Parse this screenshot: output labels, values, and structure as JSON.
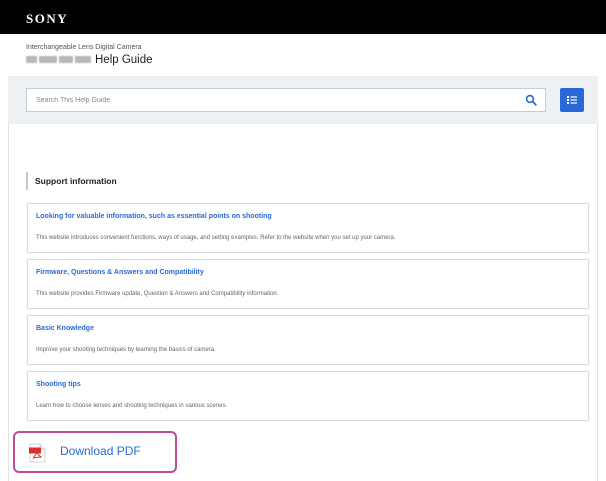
{
  "topbar": {
    "brand": "SONY"
  },
  "header": {
    "subtitle": "Interchangeable Lens Digital Camera",
    "guide_title": "Help Guide"
  },
  "search": {
    "placeholder": "Search This Help Guide",
    "icon": "search-icon"
  },
  "toc_button": {
    "icon": "list-icon"
  },
  "support": {
    "heading": "Support information",
    "items": [
      {
        "title": "Looking for valuable information, such as essential points on shooting",
        "desc": "This website introduces convenient functions, ways of usage, and setting examples. Refer to the website when you set up your camera."
      },
      {
        "title": "Firmware, Questions & Answers and Compatibility",
        "desc": "This website provides Firmware update, Question & Answers and Compatibility information."
      },
      {
        "title": "Basic Knowledge",
        "desc": "Improve your shooting techniques by learning the basics of camera."
      },
      {
        "title": "Shooting tips",
        "desc": "Learn how to choose lenses and shooting techniques in various scenes."
      }
    ]
  },
  "pdf": {
    "label": "Download PDF",
    "icon": "pdf-file-icon"
  },
  "colors": {
    "brand_bar": "#000000",
    "accent": "#2a6ad6",
    "highlight": "#c24a9b",
    "search_band": "#eef1f4"
  }
}
